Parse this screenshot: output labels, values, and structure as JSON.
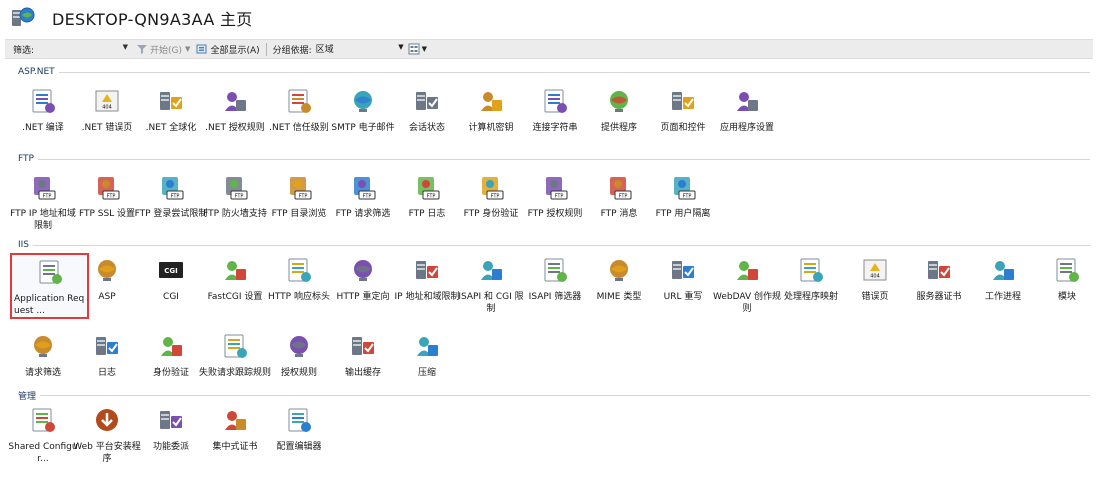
{
  "window": {
    "title": "DESKTOP-QN9A3AA 主页",
    "icon": "server-globe-icon"
  },
  "toolbar": {
    "filter_label": "筛选:",
    "filter_value": "",
    "start_label": "开始(G)",
    "show_all_label": "全部显示(A)",
    "group_by_label": "分组依据:",
    "group_by_value": "区域",
    "view_icon": "view-mode-icon"
  },
  "groups": [
    {
      "name": "ASP.NET",
      "items": [
        {
          "label": ".NET 编译",
          "icon": "net-compile-icon"
        },
        {
          "label": ".NET 错误页",
          "icon": "net-error-pages-icon"
        },
        {
          "label": ".NET 全球化",
          "icon": "net-globalization-icon"
        },
        {
          "label": ".NET 授权规则",
          "icon": "net-authorization-icon"
        },
        {
          "label": ".NET 信任级别",
          "icon": "net-trust-levels-icon"
        },
        {
          "label": "SMTP 电子邮件",
          "icon": "smtp-email-icon"
        },
        {
          "label": "会话状态",
          "icon": "session-state-icon"
        },
        {
          "label": "计算机密钥",
          "icon": "machine-key-icon"
        },
        {
          "label": "连接字符串",
          "icon": "connection-strings-icon"
        },
        {
          "label": "提供程序",
          "icon": "providers-icon"
        },
        {
          "label": "页面和控件",
          "icon": "pages-controls-icon"
        },
        {
          "label": "应用程序设置",
          "icon": "app-settings-icon"
        }
      ]
    },
    {
      "name": "FTP",
      "items": [
        {
          "label": "FTP IP 地址和域限制",
          "icon": "ftp-ip-restrictions-icon"
        },
        {
          "label": "FTP SSL 设置",
          "icon": "ftp-ssl-icon"
        },
        {
          "label": "FTP 登录尝试限制",
          "icon": "ftp-logon-attempt-icon"
        },
        {
          "label": "FTP 防火墙支持",
          "icon": "ftp-firewall-icon"
        },
        {
          "label": "FTP 目录浏览",
          "icon": "ftp-directory-browsing-icon"
        },
        {
          "label": "FTP 请求筛选",
          "icon": "ftp-request-filtering-icon"
        },
        {
          "label": "FTP 日志",
          "icon": "ftp-logging-icon"
        },
        {
          "label": "FTP 身份验证",
          "icon": "ftp-authentication-icon"
        },
        {
          "label": "FTP 授权规则",
          "icon": "ftp-authorization-icon"
        },
        {
          "label": "FTP 消息",
          "icon": "ftp-messages-icon"
        },
        {
          "label": "FTP 用户隔离",
          "icon": "ftp-user-isolation-icon"
        }
      ]
    },
    {
      "name": "IIS",
      "items": [
        {
          "label": "Application Request ...",
          "icon": "arr-server-icon",
          "selected": true
        },
        {
          "label": "ASP",
          "icon": "asp-icon"
        },
        {
          "label": "CGI",
          "icon": "cgi-icon"
        },
        {
          "label": "FastCGI 设置",
          "icon": "fastcgi-icon"
        },
        {
          "label": "HTTP 响应标头",
          "icon": "http-response-headers-icon"
        },
        {
          "label": "HTTP 重定向",
          "icon": "http-redirect-icon"
        },
        {
          "label": "IP 地址和域限制",
          "icon": "ip-restrictions-icon"
        },
        {
          "label": "ISAPI 和 CGI 限制",
          "icon": "isapi-cgi-restrictions-icon"
        },
        {
          "label": "ISAPI 筛选器",
          "icon": "isapi-filters-icon"
        },
        {
          "label": "MIME 类型",
          "icon": "mime-types-icon"
        },
        {
          "label": "URL 重写",
          "icon": "url-rewrite-icon"
        },
        {
          "label": "WebDAV 创作规则",
          "icon": "webdav-icon"
        },
        {
          "label": "处理程序映射",
          "icon": "handler-mappings-icon"
        },
        {
          "label": "错误页",
          "icon": "error-pages-icon"
        },
        {
          "label": "服务器证书",
          "icon": "server-certificates-icon"
        },
        {
          "label": "工作进程",
          "icon": "worker-processes-icon"
        },
        {
          "label": "模块",
          "icon": "modules-icon"
        },
        {
          "label": "请求筛选",
          "icon": "request-filtering-icon"
        },
        {
          "label": "日志",
          "icon": "logging-icon"
        },
        {
          "label": "身份验证",
          "icon": "authentication-icon"
        },
        {
          "label": "失败请求跟踪规则",
          "icon": "failed-request-tracing-icon"
        },
        {
          "label": "授权规则",
          "icon": "authorization-rules-icon"
        },
        {
          "label": "输出缓存",
          "icon": "output-caching-icon"
        },
        {
          "label": "压缩",
          "icon": "compression-icon"
        }
      ]
    },
    {
      "name": "管理",
      "items": [
        {
          "label": "Shared Configur...",
          "icon": "shared-configuration-icon"
        },
        {
          "label": "Web 平台安装程序",
          "icon": "web-platform-installer-icon"
        },
        {
          "label": "功能委派",
          "icon": "feature-delegation-icon"
        },
        {
          "label": "集中式证书",
          "icon": "centralized-certificates-icon"
        },
        {
          "label": "配置编辑器",
          "icon": "configuration-editor-icon"
        }
      ]
    }
  ]
}
